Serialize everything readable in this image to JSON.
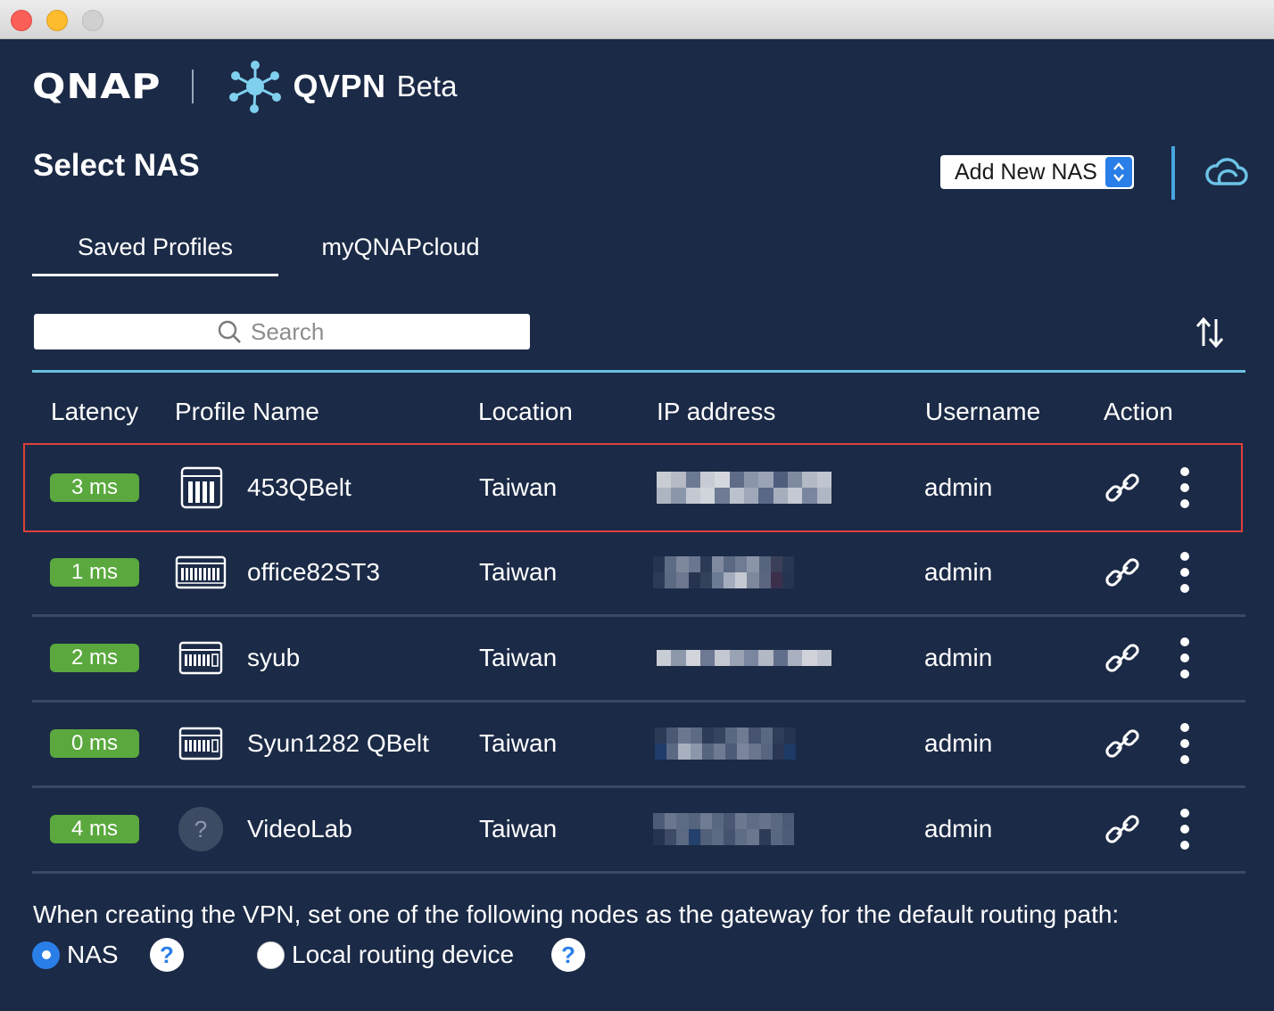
{
  "app": {
    "brand": "QNAP",
    "product": "QVPN",
    "product_tag": "Beta"
  },
  "header": {
    "title": "Select NAS",
    "add_nas_label": "Add New NAS"
  },
  "tabs": [
    {
      "label": "Saved Profiles",
      "active": true
    },
    {
      "label": "myQNAPcloud",
      "active": false
    }
  ],
  "search": {
    "placeholder": "Search",
    "value": ""
  },
  "table": {
    "columns": [
      "Latency",
      "Profile Name",
      "Location",
      "IP address",
      "Username",
      "Action"
    ],
    "rows": [
      {
        "latency": "3 ms",
        "name": "453QBelt",
        "location": "Taiwan",
        "username": "admin",
        "icon": "nas-tower-icon",
        "selected": true
      },
      {
        "latency": "1 ms",
        "name": "office82ST3",
        "location": "Taiwan",
        "username": "admin",
        "icon": "nas-rack-icon",
        "selected": false
      },
      {
        "latency": "2 ms",
        "name": "syub",
        "location": "Taiwan",
        "username": "admin",
        "icon": "nas-desktop-icon",
        "selected": false
      },
      {
        "latency": "0 ms",
        "name": "Syun1282 QBelt",
        "location": "Taiwan",
        "username": "admin",
        "icon": "nas-desktop-icon",
        "selected": false
      },
      {
        "latency": "4 ms",
        "name": "VideoLab",
        "location": "Taiwan",
        "username": "admin",
        "icon": "unknown-device-icon",
        "unknown_glyph": "?",
        "selected": false
      }
    ]
  },
  "footer": {
    "gateway_text": "When creating the VPN, set one of the following nodes as the gateway for the default routing path:",
    "options": [
      {
        "label": "NAS",
        "checked": true
      },
      {
        "label": "Local routing device",
        "checked": false
      }
    ],
    "help_glyph": "?"
  },
  "colors": {
    "background": "#1b2a46",
    "latency_badge": "#5aa83e",
    "accent_blue": "#2a7ee8",
    "teal_line": "#69c2e0",
    "selection_outline": "#e0403a"
  }
}
